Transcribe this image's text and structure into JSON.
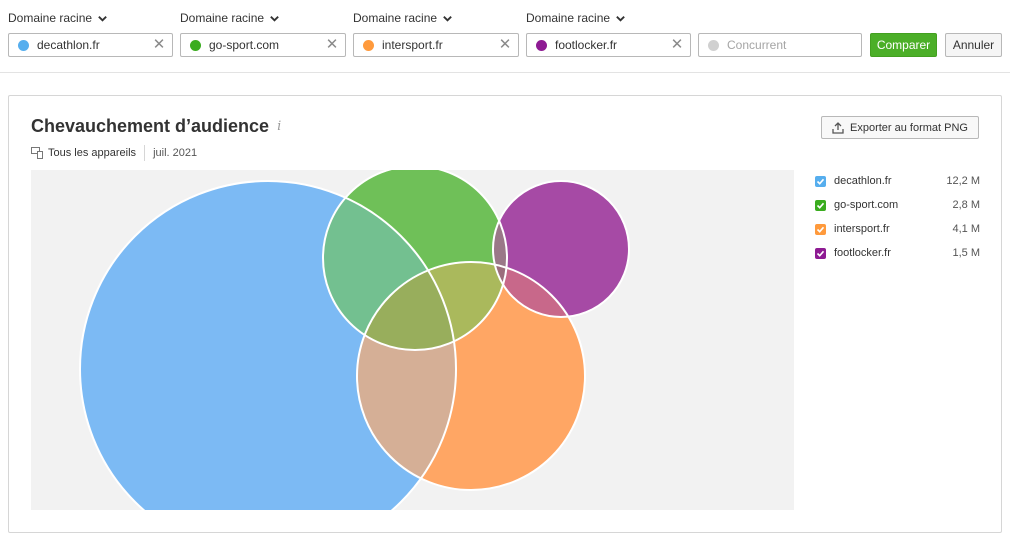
{
  "header": {
    "domains": [
      {
        "label": "Domaine racine",
        "value": "decathlon.fr",
        "color": "#56aeee"
      },
      {
        "label": "Domaine racine",
        "value": "go-sport.com",
        "color": "#3aac1f"
      },
      {
        "label": "Domaine racine",
        "value": "intersport.fr",
        "color": "#ff9a3c"
      },
      {
        "label": "Domaine racine",
        "value": "footlocker.fr",
        "color": "#8e1b93"
      }
    ],
    "competitor_placeholder": "Concurrent",
    "compare_label": "Comparer",
    "cancel_label": "Annuler",
    "clear_icon": "close-icon"
  },
  "card": {
    "title": "Chevauchement d’audience",
    "info_icon": "i",
    "devices_label": "Tous les appareils",
    "date": "juil. 2021",
    "export_label": "Exporter au format PNG"
  },
  "chart_data": {
    "type": "venn",
    "sets": [
      {
        "name": "decathlon.fr",
        "value": "12,2 M",
        "color": "#7cbaf4"
      },
      {
        "name": "go-sport.com",
        "value": "2,8 M",
        "color": "#6fc058"
      },
      {
        "name": "intersport.fr",
        "value": "4,1 M",
        "color": "#ffa664"
      },
      {
        "name": "footlocker.fr",
        "value": "1,5 M",
        "color": "#a64aa5"
      }
    ]
  }
}
